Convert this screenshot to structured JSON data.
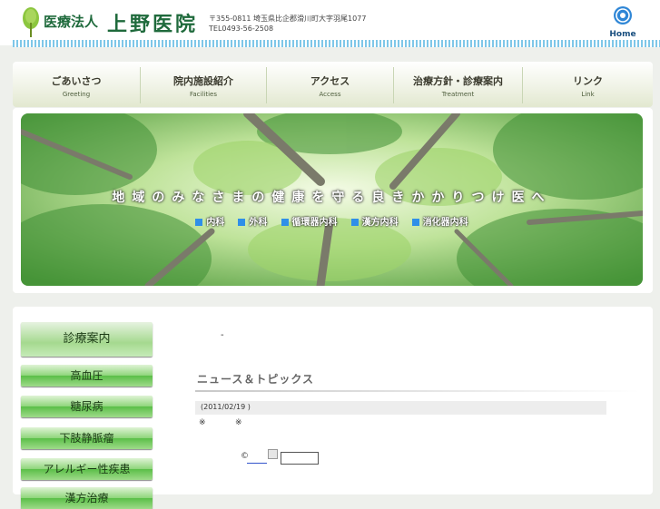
{
  "header": {
    "clinic_prefix": "医療法人",
    "clinic_name": "上野医院",
    "address": "〒355-0811 埼玉県比企郡滑川町大字羽尾1077",
    "phone": "TEL0493-56-2508",
    "home_label": "Home",
    "icons": {
      "logo": "tree-logo-icon",
      "home": "globe-home-icon"
    }
  },
  "nav": {
    "items": [
      {
        "jp": "ごあいさつ",
        "en": "Greeting"
      },
      {
        "jp": "院内施設紹介",
        "en": "Facilities"
      },
      {
        "jp": "アクセス",
        "en": "Access"
      },
      {
        "jp": "治療方針・診療案内",
        "en": "Treatment"
      },
      {
        "jp": "リンク",
        "en": "Link"
      }
    ]
  },
  "banner": {
    "slogan": "地域のみなさまの健康を守る良きかかりつけ医へ",
    "departments": [
      "内科",
      "外科",
      "循環器内科",
      "漢方内科",
      "消化器内科"
    ]
  },
  "sidebar": {
    "items": [
      "診療案内",
      "高血圧",
      "糖尿病",
      "下肢静脈瘤",
      "アレルギー性疾患",
      "漢方治療"
    ]
  },
  "content": {
    "dash": "-",
    "news_title": "ニュース＆トピックス",
    "news_date": "(2011/02/19 )",
    "mark": "※",
    "copyright": "©"
  },
  "colors": {
    "brand_green": "#1f6a3c",
    "sidebar_green": "#5bbf48",
    "dept_square": "#2f8fe8",
    "stripe_blue": "#7fc7e8"
  }
}
